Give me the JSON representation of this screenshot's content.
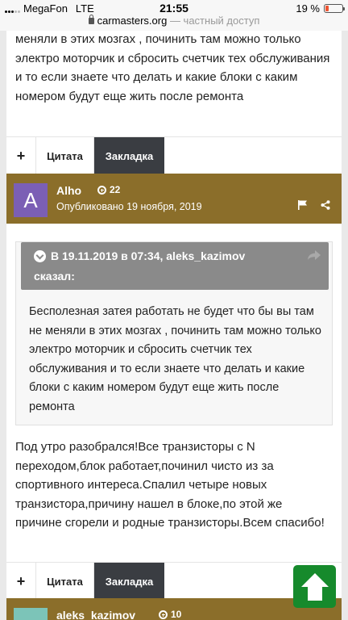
{
  "status_bar": {
    "carrier": "MegaFon",
    "network": "LTE",
    "time": "21:55",
    "battery_percent": "19 %",
    "battery_level": 0.19,
    "url": "carmasters.org",
    "url_suffix": " — частный доступ"
  },
  "post_top": {
    "text": "меняли в этих мозгах , починить там можно только электро моторчик и сбросить счетчик тех обслуживания и то если знаете что делать и какие блоки с каким номером будут еще жить после ремонта",
    "actions": {
      "plus": "+",
      "quote": "Цитата",
      "bookmark": "Закладка"
    }
  },
  "post_main": {
    "author": "Alho",
    "avatar_letter": "A",
    "reputation": "22",
    "published": "Опубликовано 19 ноября, 2019",
    "quote": {
      "header": "В 19.11.2019 в 07:34, aleks_kazimov",
      "header_line2": "сказал:",
      "text": "Бесполезная затея работать не будет что бы вы там не меняли в этих мозгах , починить там можно только электро моторчик и сбросить счетчик тех обслуживания и то если знаете что делать и какие блоки с каким номером будут еще жить после ремонта"
    },
    "text": "Под утро разобрался!Все транзисторы с N переходом,блок работает,починил чисто из за спортивного интереса.Спалил четыре новых транзистора,причину нашел в блоке,по этой же причине сгорели и родные транзисторы.Всем спасибо!",
    "actions": {
      "plus": "+",
      "quote": "Цитата",
      "bookmark": "Закладка"
    }
  },
  "post_next": {
    "author": "aleks_kazimov",
    "reputation": "10"
  },
  "colors": {
    "author_bar": "#8b6e2a",
    "bookmark_button": "#3a3d42",
    "scroll_top_button": "#168a2c",
    "avatar_alho": "#7b5fb5"
  }
}
